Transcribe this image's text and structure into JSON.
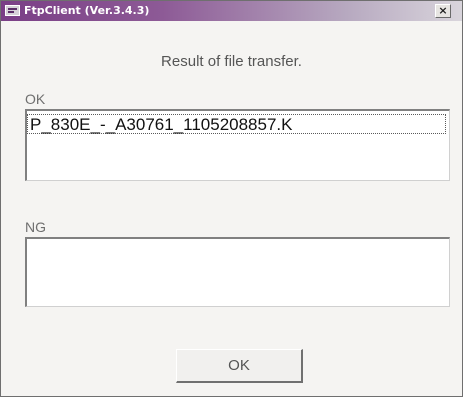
{
  "window": {
    "title": "FtpClient (Ver.3.4.3)",
    "close_glyph": "×"
  },
  "dialog": {
    "heading": "Result of file transfer."
  },
  "ok_section": {
    "label": "OK",
    "items": [
      "P_830E_-_A30761_1105208857.K"
    ]
  },
  "ng_section": {
    "label": "NG",
    "items": []
  },
  "buttons": {
    "ok_label": "OK"
  },
  "colors": {
    "titlebar_start": "#7a3f86",
    "titlebar_end": "#d9d5dc",
    "window_bg": "#f5f4f2"
  }
}
